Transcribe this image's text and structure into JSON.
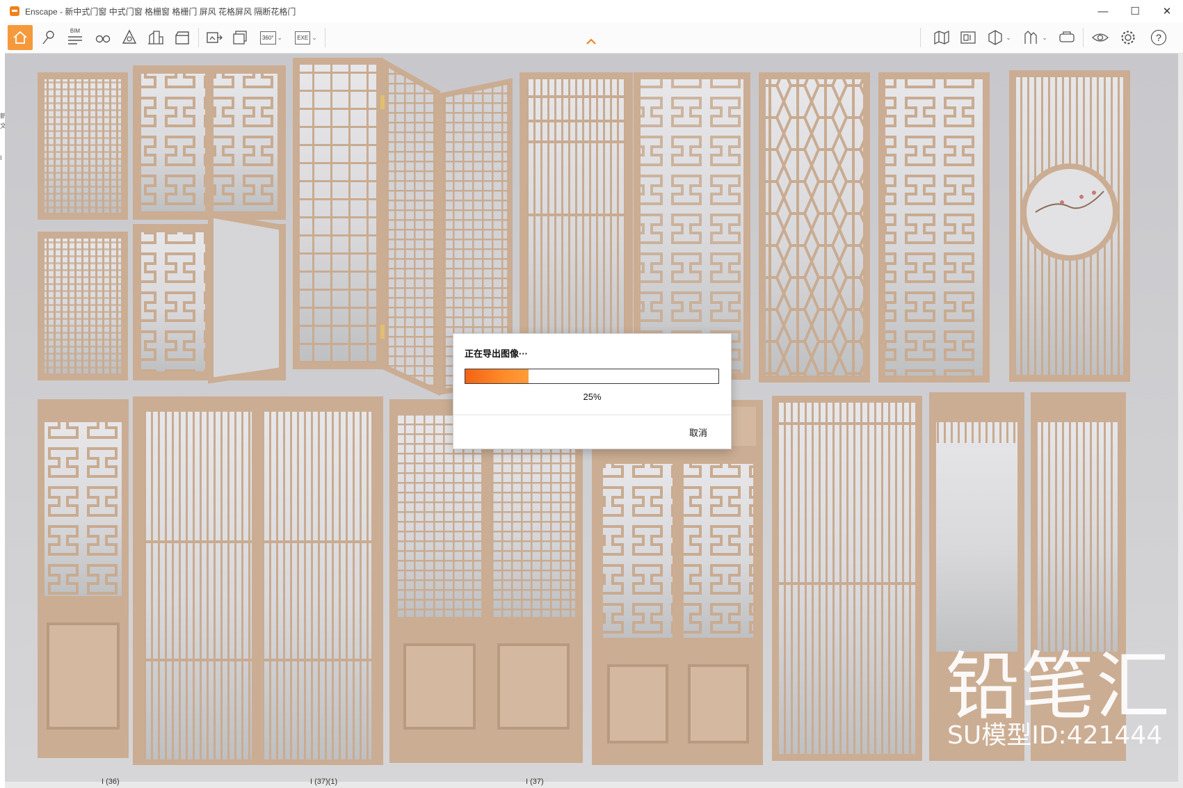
{
  "window": {
    "app_name": "Enscape",
    "title": "Enscape - 新中式门窗 中式门窗 格栅窗 格栅门 屏风 花格屏风 隔断花格门",
    "controls": {
      "minimize": "—",
      "maximize": "☐",
      "close": "✕"
    }
  },
  "toolbar": {
    "bim_label": "BIM",
    "panorama_label": "360°",
    "exe_label": "EXE",
    "help_label": "?",
    "items": [
      {
        "name": "home",
        "icon": "home-icon"
      },
      {
        "name": "views",
        "icon": "location-pin-icon"
      },
      {
        "name": "bim",
        "icon": "bim-info-icon"
      },
      {
        "name": "binoculars",
        "icon": "binoculars-icon"
      },
      {
        "name": "objects",
        "icon": "asset-library-icon"
      },
      {
        "name": "buildings",
        "icon": "building-icon"
      },
      {
        "name": "video",
        "icon": "clapperboard-icon"
      },
      {
        "name": "screenshot",
        "icon": "screenshot-export-icon"
      },
      {
        "name": "batch",
        "icon": "batch-render-icon"
      },
      {
        "name": "panorama",
        "icon": "panorama-360-icon"
      },
      {
        "name": "exe-export",
        "icon": "exe-export-icon"
      },
      {
        "name": "map",
        "icon": "map-icon"
      },
      {
        "name": "section",
        "icon": "section-plane-icon"
      },
      {
        "name": "cube",
        "icon": "cube-icon"
      },
      {
        "name": "vegetation",
        "icon": "vegetation-icon"
      },
      {
        "name": "vr",
        "icon": "vr-headset-icon"
      },
      {
        "name": "visibility",
        "icon": "eye-icon"
      },
      {
        "name": "settings",
        "icon": "gear-icon"
      },
      {
        "name": "help",
        "icon": "help-icon"
      }
    ],
    "accent_color": "#f59a3c"
  },
  "dialog": {
    "title": "正在导出图像···",
    "progress_fraction": 0.25,
    "progress_text": "25%",
    "cancel_label": "取消"
  },
  "scene_labels": [
    "I (36)",
    "I (37)(1)",
    "I (37)"
  ],
  "watermark": {
    "brand": "铅笔汇",
    "model_id": "SU模型ID:421444"
  },
  "left_strip_chars": [
    "新",
    "文",
    "Ⅰ"
  ]
}
